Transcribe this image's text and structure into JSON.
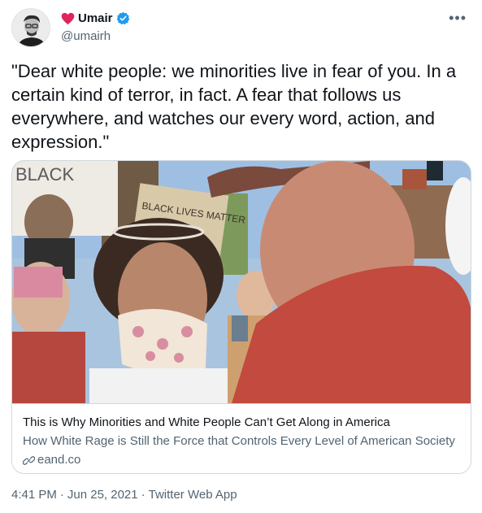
{
  "author": {
    "display_name": "Umair",
    "handle": "@umairh",
    "avatar_icon": "avatar-photo",
    "heart_icon": "red-heart-icon",
    "verified_icon": "verified-badge-icon"
  },
  "tweet": {
    "text": "\"Dear white people: we minorities live in fear of you. In a certain kind of terror, in fact. A fear that follows us everywhere, and watches our every word, action, and expression.\""
  },
  "card": {
    "title": "This is Why Minorities and White People Can’t Get Along in America",
    "description": "How White Rage is Still the Force that Controls Every Level of American Society",
    "domain": "eand.co",
    "sign_left_text": "BLACK",
    "sign_center_text": "BLACK LIVES MATTER"
  },
  "footer": {
    "time": "4:41 PM",
    "separator1": "·",
    "date": "Jun 25, 2021",
    "separator2": "·",
    "source": "Twitter Web App"
  },
  "colors": {
    "heart": "#e0245e",
    "verified": "#1d9bf0",
    "muted": "#536471",
    "border": "#cfd9de"
  }
}
